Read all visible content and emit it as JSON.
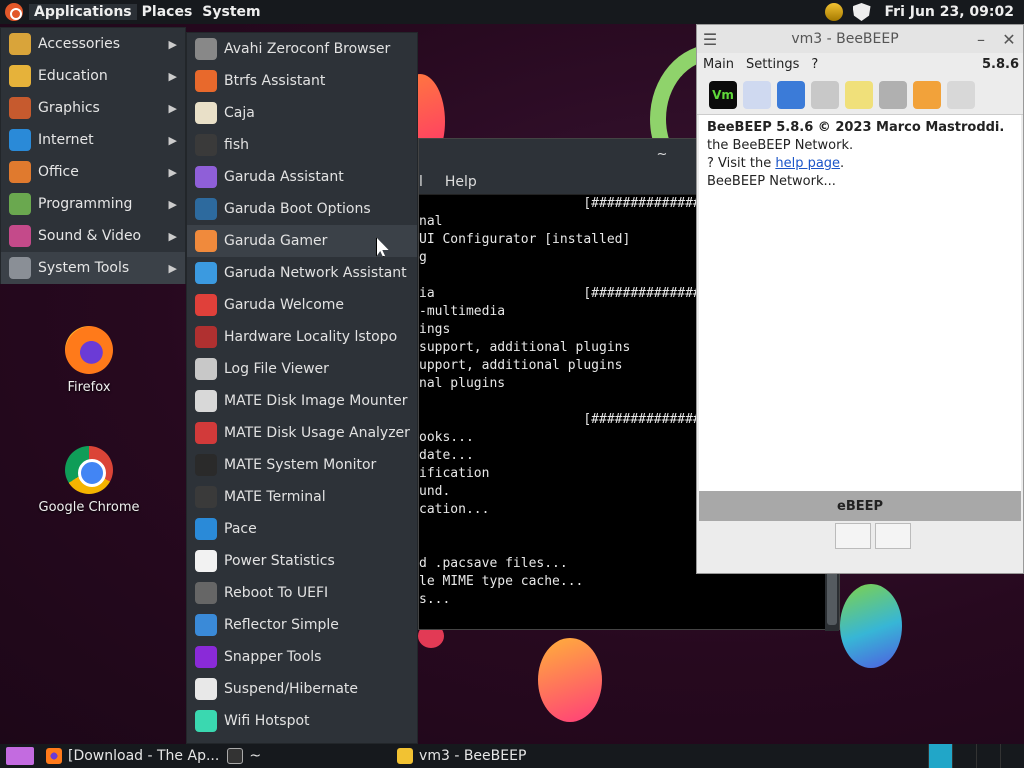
{
  "top_panel": {
    "applications_label": "Applications",
    "places_label": "Places",
    "system_label": "System",
    "clock": "Fri Jun 23, 09:02"
  },
  "desktop": {
    "icons": [
      {
        "label": "Firefox"
      },
      {
        "label": "Google Chrome"
      }
    ]
  },
  "categories": [
    {
      "label": "Accessories",
      "color": "#d9a43a"
    },
    {
      "label": "Education",
      "color": "#e6b23a"
    },
    {
      "label": "Graphics",
      "color": "#c65a2e"
    },
    {
      "label": "Internet",
      "color": "#2a8ad8"
    },
    {
      "label": "Office",
      "color": "#e07a2e"
    },
    {
      "label": "Programming",
      "color": "#6aa84f"
    },
    {
      "label": "Sound & Video",
      "color": "#c44a8a"
    },
    {
      "label": "System Tools",
      "color": "#8a8f96"
    }
  ],
  "system_tools": [
    {
      "label": "Avahi Zeroconf Browser",
      "color": "#888"
    },
    {
      "label": "Btrfs Assistant",
      "color": "#e8692c"
    },
    {
      "label": "Caja",
      "color": "#e9e0c8"
    },
    {
      "label": "fish",
      "color": "#3a3a3a"
    },
    {
      "label": "Garuda Assistant",
      "color": "#8f5fd8"
    },
    {
      "label": "Garuda Boot Options",
      "color": "#2d6a9e"
    },
    {
      "label": "Garuda Gamer",
      "color": "#f08a3c"
    },
    {
      "label": "Garuda Network Assistant",
      "color": "#3b9ae0"
    },
    {
      "label": "Garuda Welcome",
      "color": "#e0403a"
    },
    {
      "label": "Hardware Locality lstopo",
      "color": "#b03030"
    },
    {
      "label": "Log File Viewer",
      "color": "#c8c8c8"
    },
    {
      "label": "MATE Disk Image Mounter",
      "color": "#d8d8d8"
    },
    {
      "label": "MATE Disk Usage Analyzer",
      "color": "#d23a3a"
    },
    {
      "label": "MATE System Monitor",
      "color": "#2a2a2a"
    },
    {
      "label": "MATE Terminal",
      "color": "#3a3a3a"
    },
    {
      "label": "Pace",
      "color": "#2a8ad8"
    },
    {
      "label": "Power Statistics",
      "color": "#f2f2f2"
    },
    {
      "label": "Reboot To UEFI",
      "color": "#666"
    },
    {
      "label": "Reflector Simple",
      "color": "#3a8ad8"
    },
    {
      "label": "Snapper Tools",
      "color": "#8a2ad8"
    },
    {
      "label": "Suspend/Hibernate",
      "color": "#e8e8e8"
    },
    {
      "label": "Wifi Hotspot",
      "color": "#3ad8b0"
    }
  ],
  "terminal": {
    "title": "~",
    "menu_partial": "l",
    "menu_help": "Help",
    "lines": [
      "                     [######################] 100%",
      "nal",
      "UI Configurator [installed]",
      "g",
      "",
      "ia                   [######################] 100%",
      "-multimedia",
      "ings",
      "support, additional plugins",
      "upport, additional plugins",
      "nal plugins",
      "",
      "                     [######################] 100%",
      "ooks...",
      "date...",
      "ification",
      "und.",
      "cation...",
      "",
      "",
      "d .pacsave files...",
      "le MIME type cache...",
      "s..."
    ]
  },
  "beebeep": {
    "title": "vm3 - BeeBEEP",
    "menu_main": "Main",
    "menu_settings": "Settings",
    "menu_help": "?",
    "version": "5.8.6",
    "toolbar_vm": "Vm",
    "info_head": "BeeBEEP 5.8.6 © 2023 Marco Mastroddi.",
    "info_line2": "the BeeBEEP Network.",
    "info_line3_pre": "? Visit the ",
    "info_link": "help page",
    "info_line3_post": ".",
    "info_line4": "BeeBEEP Network...",
    "status": "eBEEP"
  },
  "bottom_panel": {
    "task_firefox": "[Download - The Ap...",
    "task_terminal": "~",
    "task_beebeep": "vm3 - BeeBEEP"
  }
}
